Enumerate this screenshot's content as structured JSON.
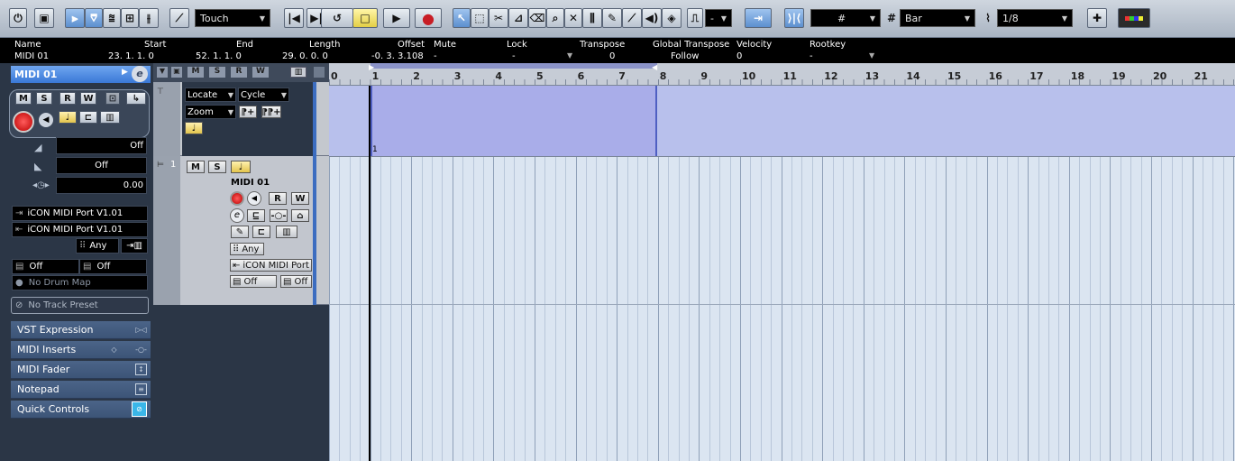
{
  "toolbar": {
    "automation_mode": "Touch",
    "nudge_value": "-",
    "snap_quantize": "#",
    "grid_type": "Bar",
    "quantize_value": "1/8"
  },
  "info_line": {
    "headers": [
      "Name",
      "Start",
      "End",
      "Length",
      "Offset",
      "Mute",
      "Lock",
      "Transpose",
      "Global Transpose",
      "Velocity",
      "Rootkey"
    ],
    "values": [
      "MIDI 01",
      "23. 1. 1.   0",
      "52. 1. 1.   0",
      "29. 0. 0.   0",
      "-0. 3. 3.108",
      "-",
      "-",
      "0",
      "Follow",
      "0",
      "-"
    ]
  },
  "inspector": {
    "track_name": "MIDI 01",
    "volume_value": "Off",
    "pan_value": "Off",
    "delay_value": "0.00",
    "input_port": "iCON MIDI Port V1.01",
    "output_port": "iCON MIDI Port V1.01",
    "channel": "Any",
    "program": "Off",
    "bank": "Off",
    "drum_map": "No Drum Map",
    "track_preset": "No Track Preset",
    "sections": [
      "VST Expression",
      "MIDI Inserts",
      "MIDI Fader",
      "Notepad",
      "Quick Controls"
    ]
  },
  "ruler_track": {
    "locate": "Locate",
    "cycle": "Cycle",
    "zoom": "Zoom"
  },
  "ruler": {
    "bars": [
      "0",
      "1",
      "2",
      "3",
      "4",
      "5",
      "6",
      "7",
      "8",
      "9",
      "10",
      "11",
      "12",
      "13",
      "14",
      "15",
      "16",
      "17",
      "18",
      "19",
      "20",
      "21"
    ]
  },
  "midi_track": {
    "number": "1",
    "name": "MIDI 01",
    "channel": "Any",
    "output": "iCON MIDI Port",
    "program": "Off",
    "bank": "Off"
  },
  "marker": {
    "label": "1"
  },
  "colors": {
    "accent": "#5c8fcf",
    "record": "#d8232a",
    "part": "#b3b8ec",
    "grid": "#dbe5f1"
  }
}
